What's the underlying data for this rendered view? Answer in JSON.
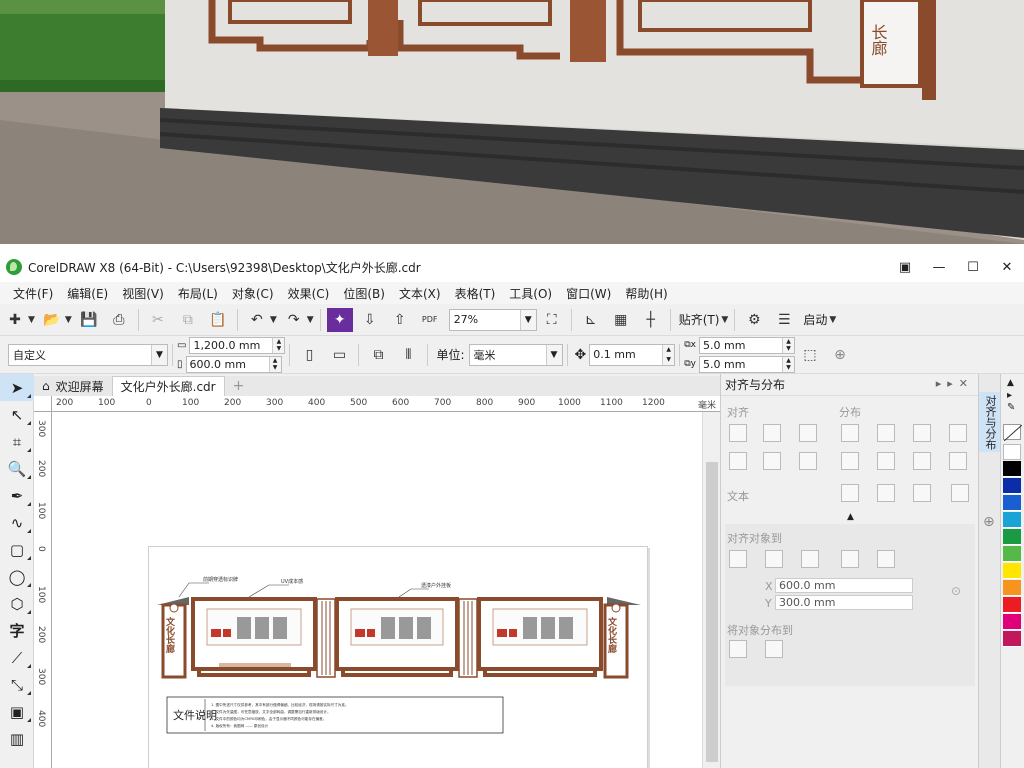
{
  "scene": {
    "plaque_text": "长廊"
  },
  "window": {
    "title": "CorelDRAW X8 (64-Bit) - C:\\Users\\92398\\Desktop\\文化户外长廊.cdr",
    "controls": [
      "—",
      "☐",
      "✕"
    ]
  },
  "menu": [
    "文件(F)",
    "编辑(E)",
    "视图(V)",
    "布局(L)",
    "对象(C)",
    "效果(C)",
    "位图(B)",
    "文本(X)",
    "表格(T)",
    "工具(O)",
    "窗口(W)",
    "帮助(H)"
  ],
  "toolbar1": {
    "zoom": "27%",
    "snap_label": "贴齐(T)",
    "launch_label": "启动"
  },
  "toolbar2": {
    "preset": "自定义",
    "width": "1,200.0 mm",
    "height": "600.0 mm",
    "unit_label": "单位:",
    "unit": "毫米",
    "nudge": "0.1 mm",
    "dup_x": "5.0 mm",
    "dup_y": "5.0 mm"
  },
  "tabs": {
    "welcome": "欢迎屏幕",
    "document": "文化户外长廊.cdr",
    "plus": "+"
  },
  "ruler": {
    "unit": "毫米",
    "ticks": [
      "200",
      "100",
      "0",
      "100",
      "200",
      "300",
      "400",
      "500",
      "600",
      "700",
      "800",
      "900",
      "1000",
      "1100",
      "1200"
    ],
    "v_ticks": [
      "300",
      "200",
      "100",
      "0",
      "100",
      "200",
      "300",
      "400"
    ]
  },
  "drawing": {
    "callout_1": "前期穿透标识牌",
    "callout_2": "UV成本感",
    "callout_3": "透漆户外挂板",
    "plaque_left": "文化长廊",
    "plaque_right": "文化长廊",
    "note_title": "文件说明",
    "note_lines": [
      "1. 图中所述尺寸仅供参考，其中有部分做得偏细、比较经济，现场请按实际尺寸为准。",
      "2. 文件为矢量图，可任意缩放，文字全部转曲，调整需自行重新排版设计。",
      "3. 文件中的颜色均为CMYK印刷色，由于显示器不同颜色可能存在偏差。",
      "4. 版权所有：我图网 —— 原创设计"
    ]
  },
  "docker": {
    "title": "对齐与分布",
    "align": "对齐",
    "distribute": "分布",
    "text": "文本",
    "align_to": "对齐对象到",
    "x_value": "600.0 mm",
    "y_value": "300.0 mm",
    "x_label": "X",
    "y_label": "Y",
    "distribute_to": "将对象分布到",
    "side_tab": "对齐与分布"
  },
  "colors": {
    "wood": "#8a4a2c",
    "wall": "#e4e2df",
    "accent_green": "#2e9e3a"
  },
  "palette": [
    "#ffffff",
    "#000000",
    "#0b2ea8",
    "#1a5fd0",
    "#19a3d6",
    "#1a9a43",
    "#54b948",
    "#ffe500",
    "#f7941d",
    "#ed1c24",
    "#e0007a",
    "#c2185b"
  ]
}
